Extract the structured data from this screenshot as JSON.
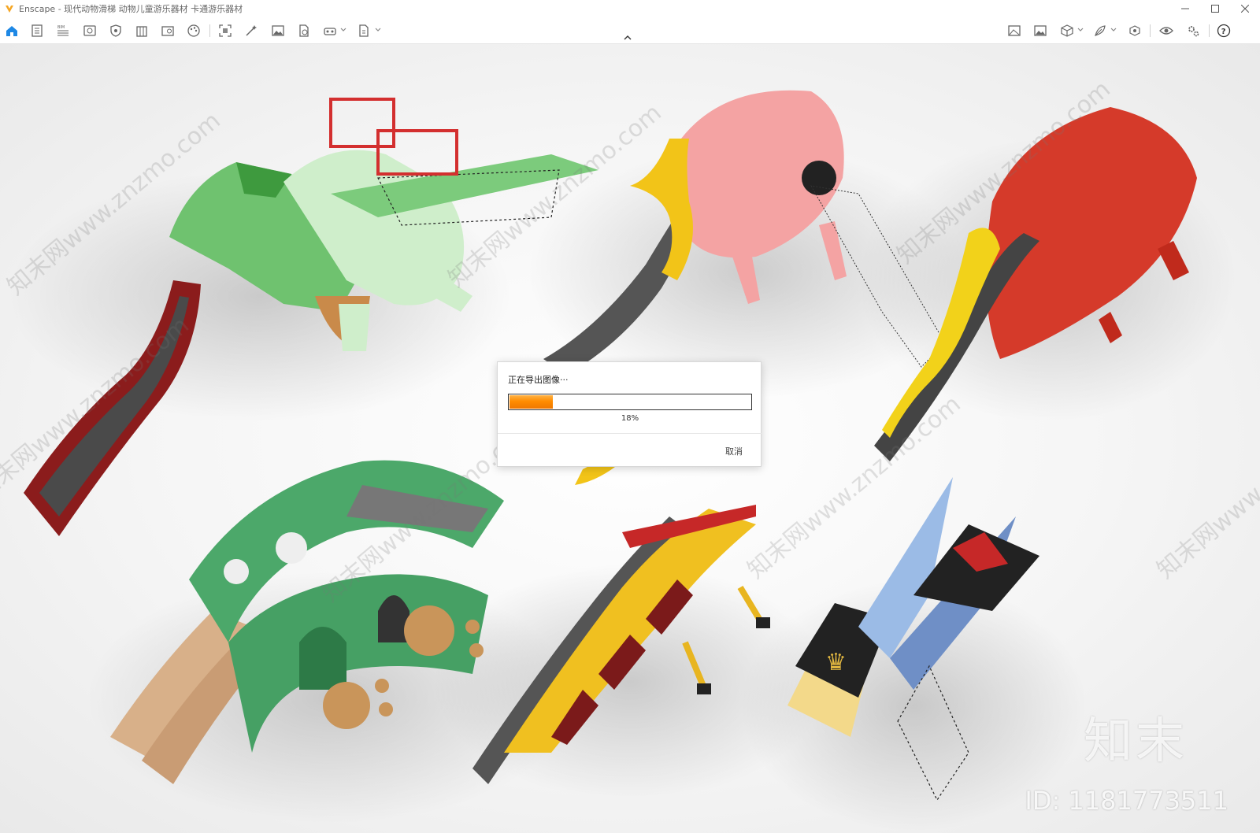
{
  "window": {
    "title": "Enscape - 现代动物滑梯 动物儿童游乐器材 卡通游乐器材",
    "controls": [
      "minimize",
      "maximize",
      "close"
    ]
  },
  "toolbar": {
    "left_icons": [
      "home-icon",
      "document-icon",
      "bim-icon",
      "view-icon",
      "shield-icon",
      "building-icon",
      "book-icon",
      "palette-icon",
      "screenshot-icon",
      "magic-icon",
      "image-icon",
      "export-icon",
      "vr-headset-icon",
      "file-export-icon"
    ],
    "right_icons": [
      "landscape-icon",
      "gallery-icon",
      "cube-icon",
      "feather-icon",
      "vr-icon",
      "eye-icon",
      "settings-icon",
      "help-icon"
    ]
  },
  "dialog": {
    "title": "正在导出图像···",
    "progress": 0.18,
    "progress_label": "18%",
    "cancel_label": "取消"
  },
  "watermark": {
    "logo_text": "知末",
    "id_text": "ID: 1181773511",
    "site_text": "知末网www.znzmo.com"
  },
  "colors": {
    "accent": "#1e88e5",
    "progress": "#ff8c00"
  }
}
